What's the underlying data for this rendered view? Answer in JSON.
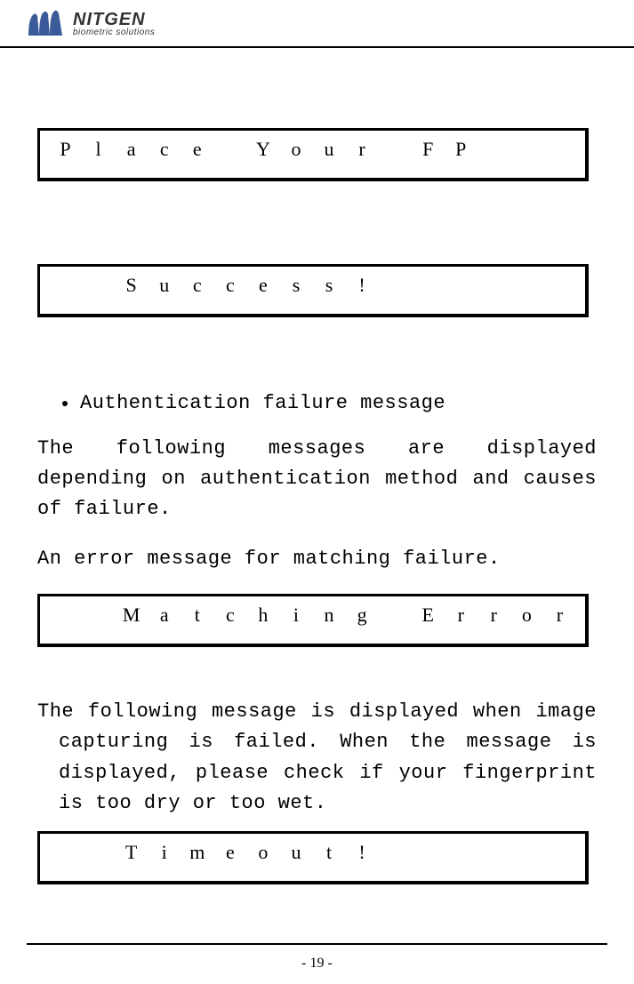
{
  "header": {
    "brand": "NITGEN",
    "tagline": "biometric solutions"
  },
  "boxes": {
    "place": [
      "P",
      "l",
      "a",
      "c",
      "e",
      "",
      "Y",
      "o",
      "u",
      "r",
      "",
      "F",
      "P",
      "",
      "",
      ""
    ],
    "success": [
      "",
      "",
      "S",
      "u",
      "c",
      "c",
      "e",
      "s",
      "s",
      "!",
      "",
      "",
      "",
      "",
      "",
      ""
    ],
    "matching": [
      "",
      "",
      "M",
      "a",
      "t",
      "c",
      "h",
      "i",
      "n",
      "g",
      "",
      "E",
      "r",
      "r",
      "o",
      "r"
    ],
    "timeout": [
      "",
      "",
      "T",
      "i",
      "m",
      "e",
      "o",
      "u",
      "t",
      "!",
      "",
      "",
      "",
      "",
      "",
      ""
    ]
  },
  "bullet1": "Authentication failure message",
  "para1": "The following messages are displayed depending on authentication method and causes of failure.",
  "para2": "An error message for matching failure.",
  "para3": "The following message is displayed when image capturing is failed. When the message is displayed, please check if your fingerprint is too dry or too wet.",
  "footer": "- 19 -"
}
